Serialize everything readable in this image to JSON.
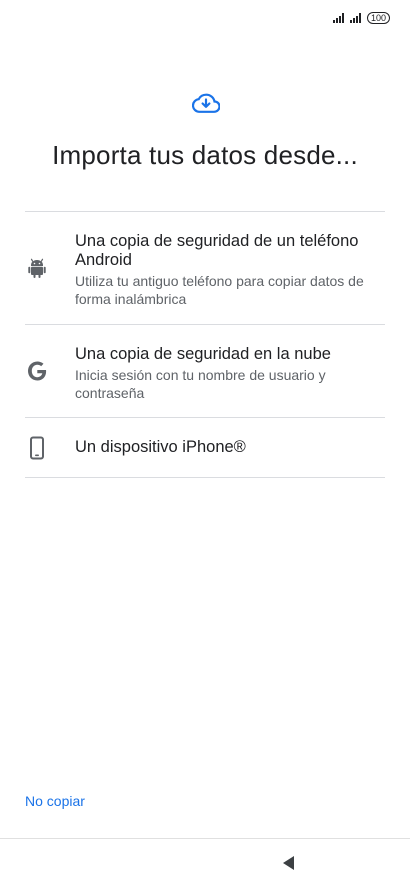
{
  "status_bar": {
    "battery_label": "100",
    "signal_icon": "signal-bars-icon",
    "battery_icon": "battery-icon"
  },
  "header": {
    "icon": "cloud-download-icon",
    "title": "Importa tus datos desde..."
  },
  "options": [
    {
      "icon": "android-icon",
      "title": "Una copia de seguridad de un teléfono Android",
      "subtitle": "Utiliza tu antiguo teléfono para copiar datos de forma inalámbrica"
    },
    {
      "icon": "google-g-icon",
      "title": "Una copia de seguridad en la nube",
      "subtitle": "Inicia sesión con tu nombre de usuario y contraseña"
    },
    {
      "icon": "phone-device-icon",
      "title": "Un dispositivo iPhone®"
    }
  ],
  "footer": {
    "skip_label": "No copiar"
  },
  "navigation": {
    "back_icon": "back-triangle-icon"
  },
  "colors": {
    "accent": "#1a73e8",
    "text_primary": "#202124",
    "text_secondary": "#5f6368",
    "divider": "#dadce0"
  }
}
